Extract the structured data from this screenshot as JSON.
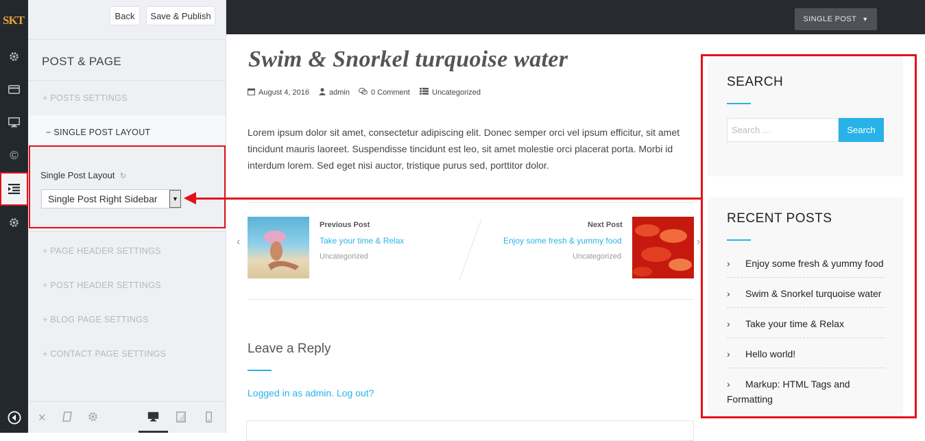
{
  "rail": {
    "logo": "SKT"
  },
  "panel": {
    "back_label": "Back",
    "publish_label": "Save & Publish",
    "section_title": "POST & PAGE",
    "sections": [
      "+ POSTS SETTINGS",
      "− SINGLE POST LAYOUT",
      "+ PAGE HEADER SETTINGS",
      "+ POST HEADER SETTINGS",
      "+ BLOG PAGE SETTINGS",
      "+ CONTACT PAGE SETTINGS"
    ],
    "control_label": "Single Post Layout",
    "select_value": "Single Post Right Sidebar"
  },
  "preview": {
    "dropdown_label": "SINGLE POST",
    "post": {
      "title": "Swim & Snorkel turquoise water",
      "date": "August 4, 2016",
      "author": "admin",
      "comments": "0 Comment",
      "category": "Uncategorized",
      "body": "Lorem ipsum dolor sit amet, consectetur adipiscing elit. Donec semper orci vel ipsum efficitur, sit amet tincidunt mauris laoreet. Suspendisse tincidunt est leo, sit amet molestie orci placerat porta. Morbi id interdum lorem. Sed eget nisi auctor, tristique purus sed, porttitor dolor."
    },
    "nav": {
      "prev_label": "Previous Post",
      "prev_title": "Take your time & Relax",
      "prev_cat": "Uncategorized",
      "next_label": "Next Post",
      "next_title": "Enjoy some fresh & yummy food",
      "next_cat": "Uncategorized"
    },
    "reply": {
      "title": "Leave a Reply",
      "logged_in": "Logged in as admin.",
      "logout": "Log out?"
    }
  },
  "sidebar": {
    "search_title": "SEARCH",
    "search_placeholder": "Search …",
    "search_button": "Search",
    "recent_title": "RECENT POSTS",
    "recent_posts": [
      "Enjoy some fresh & yummy food",
      "Swim & Snorkel turquoise water",
      "Take your time & Relax",
      "Hello world!",
      "Markup: HTML Tags and Formatting"
    ]
  },
  "colors": {
    "accent": "#29b2e8",
    "highlight": "#e3101a",
    "topbar": "#272a30",
    "rail": "#23282d"
  }
}
